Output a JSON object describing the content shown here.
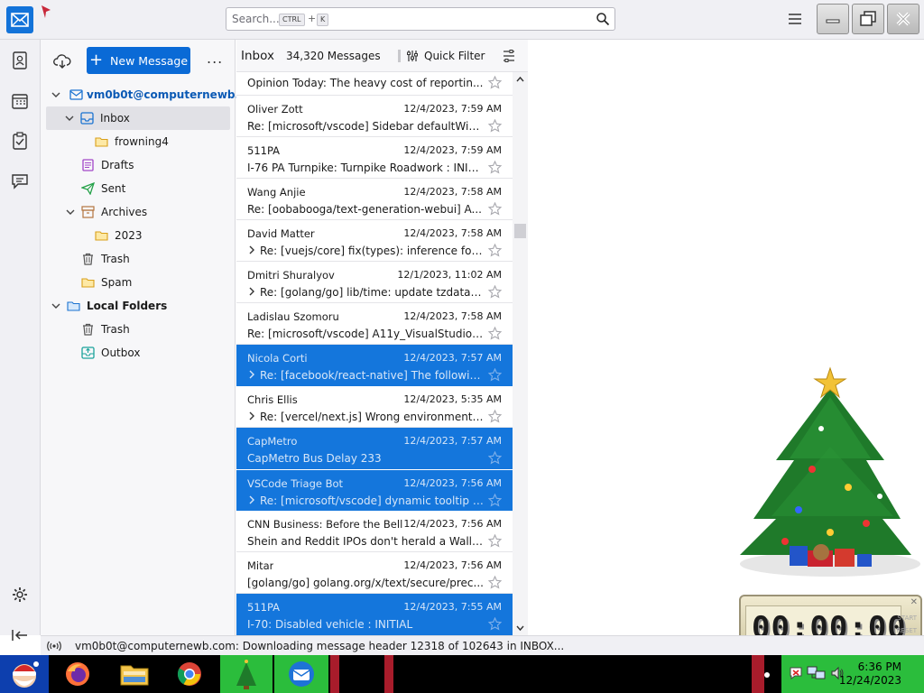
{
  "search": {
    "placeholder": "Search...",
    "kbd1": "CTRL",
    "plus": "+",
    "kbd2": "K"
  },
  "folder_pane": {
    "new_message_label": "New Message",
    "more_label": "...",
    "account": "vm0b0t@computernewb...",
    "folders": {
      "inbox": "Inbox",
      "frowning4": "frowning4",
      "drafts": "Drafts",
      "sent": "Sent",
      "archives": "Archives",
      "year_2023": "2023",
      "trash": "Trash",
      "spam": "Spam",
      "local_folders": "Local Folders",
      "local_trash": "Trash",
      "outbox": "Outbox"
    }
  },
  "thread_pane": {
    "title": "Inbox",
    "count": "34,320 Messages",
    "quick_filter_label": "Quick Filter",
    "first_partial_subject": "Opinion Today: The heavy cost of reportin...",
    "messages": [
      {
        "sender": "Oliver Zott",
        "date": "12/4/2023, 7:59 AM",
        "subject": "Re: [microsoft/vscode] Sidebar defaultWid...",
        "thread": false,
        "selected": false
      },
      {
        "sender": "511PA",
        "date": "12/4/2023, 7:59 AM",
        "subject": "I-76 PA Turnpike: Turnpike Roadwork : INITI...",
        "thread": false,
        "selected": false
      },
      {
        "sender": "Wang Anjie",
        "date": "12/4/2023, 7:58 AM",
        "subject": "Re: [oobabooga/text-generation-webui] A...",
        "thread": false,
        "selected": false
      },
      {
        "sender": "David Matter",
        "date": "12/4/2023, 7:58 AM",
        "subject": "Re: [vuejs/core] fix(types): inference for ...",
        "thread": true,
        "selected": false
      },
      {
        "sender": "Dmitri Shuralyov",
        "date": "12/1/2023, 11:02 AM",
        "subject": "Re: [golang/go] lib/time: update tzdata ...",
        "thread": true,
        "selected": false
      },
      {
        "sender": "Ladislau Szomoru",
        "date": "12/4/2023, 7:58 AM",
        "subject": "Re: [microsoft/vscode] A11y_VisualStudioC...",
        "thread": false,
        "selected": false
      },
      {
        "sender": "Nicola Corti",
        "date": "12/4/2023, 7:57 AM",
        "subject": "Re: [facebook/react-native] The followin...",
        "thread": true,
        "selected": true
      },
      {
        "sender": "Chris Ellis",
        "date": "12/4/2023, 5:35 AM",
        "subject": "Re: [vercel/next.js] Wrong environment v...",
        "thread": true,
        "selected": false
      },
      {
        "sender": "CapMetro",
        "date": "12/4/2023, 7:57 AM",
        "subject": "CapMetro Bus Delay 233",
        "thread": false,
        "selected": true
      },
      {
        "sender": "VSCode Triage Bot",
        "date": "12/4/2023, 7:56 AM",
        "subject": "Re: [microsoft/vscode] dynamic tooltip (...",
        "thread": true,
        "selected": true
      },
      {
        "sender": "CNN Business: Before the Bell",
        "date": "12/4/2023, 7:56 AM",
        "subject": "Shein and Reddit IPOs don't herald a Wall ...",
        "thread": false,
        "selected": false
      },
      {
        "sender": "Mitar",
        "date": "12/4/2023, 7:56 AM",
        "subject": "[golang/go] golang.org/x/text/secure/prec...",
        "thread": false,
        "selected": false
      },
      {
        "sender": "511PA",
        "date": "12/4/2023, 7:55 AM",
        "subject": "I-70: Disabled vehicle : INITIAL",
        "thread": false,
        "selected": true
      }
    ]
  },
  "status_bar": {
    "text": "vm0b0t@computernewb.com: Downloading message header 12318 of 102643 in INBOX..."
  },
  "timer_gadget": {
    "display": "00:00:00",
    "start": "START",
    "reset": "RESET"
  },
  "taskbar": {
    "time": "6:36 PM",
    "date": "12/24/2023"
  },
  "colors": {
    "accent": "#0a6ad6",
    "selection": "#1476dc",
    "taskbar_green": "#2bbd3c"
  }
}
